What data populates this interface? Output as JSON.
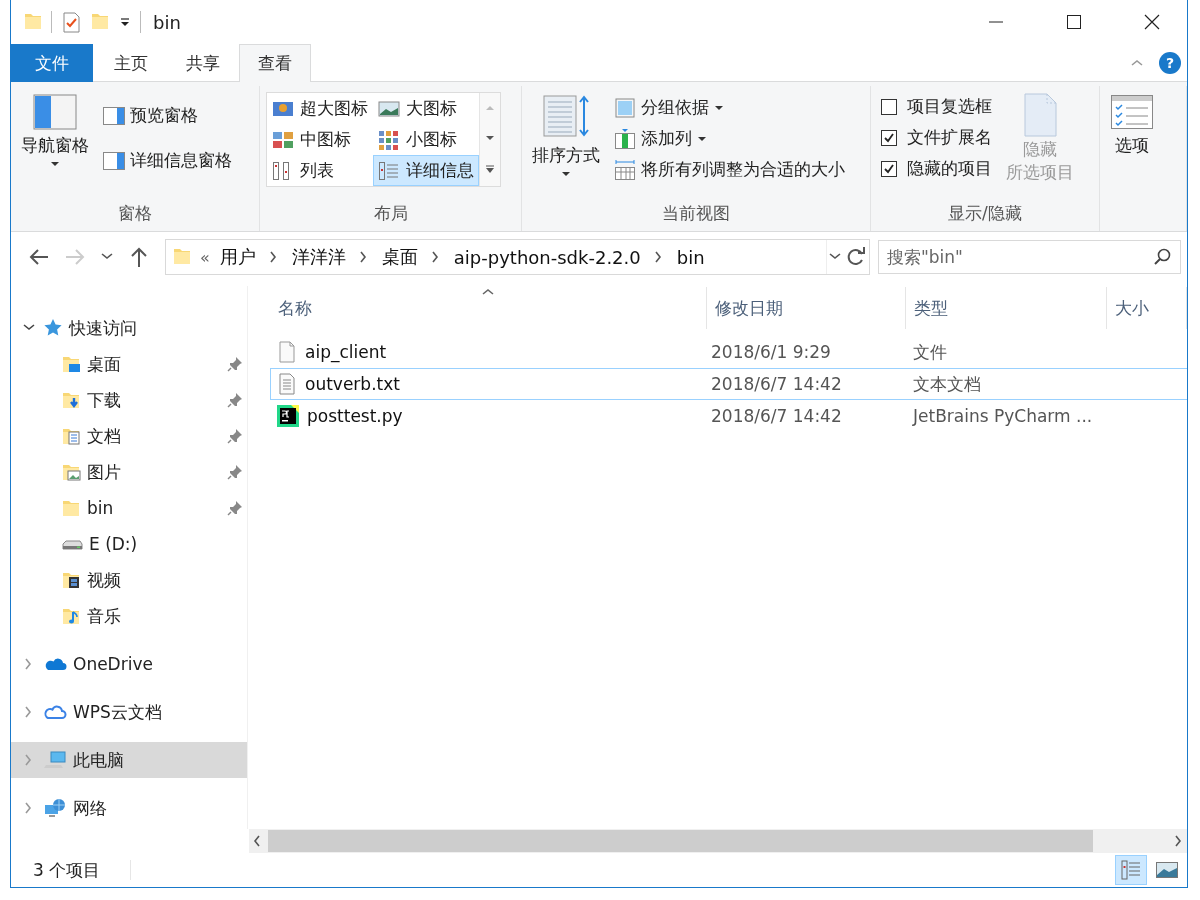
{
  "window": {
    "title": "bin"
  },
  "ribbon_tabs": [
    {
      "label": "文件",
      "kind": "file",
      "selected": false
    },
    {
      "label": "主页",
      "kind": "tab",
      "selected": false
    },
    {
      "label": "共享",
      "kind": "tab",
      "selected": false
    },
    {
      "label": "查看",
      "kind": "tab",
      "selected": true
    }
  ],
  "help": "?",
  "panes": {
    "title": "窗格",
    "nav_pane": "导航窗格",
    "preview_pane": "预览窗格",
    "details_pane": "详细信息窗格"
  },
  "layout": {
    "title": "布局",
    "options": [
      {
        "label": "超大图标",
        "kind": "xl",
        "selected": false
      },
      {
        "label": "大图标",
        "kind": "large",
        "selected": false
      },
      {
        "label": "中图标",
        "kind": "medium",
        "selected": false
      },
      {
        "label": "小图标",
        "kind": "small",
        "selected": false
      },
      {
        "label": "列表",
        "kind": "list",
        "selected": false
      },
      {
        "label": "详细信息",
        "kind": "details",
        "selected": true
      }
    ]
  },
  "current_view": {
    "title": "当前视图",
    "sort": "排序方式",
    "group_by": "分组依据",
    "add_column": "添加列",
    "fit_columns": "将所有列调整为合适的大小"
  },
  "show_hide": {
    "title": "显示/隐藏",
    "checkboxes": [
      {
        "label": "项目复选框",
        "checked": false
      },
      {
        "label": "文件扩展名",
        "checked": true
      },
      {
        "label": "隐藏的项目",
        "checked": true
      }
    ],
    "hide_selected": {
      "lines": [
        "隐藏",
        "所选项目"
      ],
      "disabled": true
    }
  },
  "options": {
    "label": "选项"
  },
  "address": {
    "overflow": "«",
    "path": [
      "用户",
      "洋洋洋",
      "桌面",
      "aip-python-sdk-2.2.0",
      "bin"
    ]
  },
  "search": {
    "placeholder": "搜索\"bin\""
  },
  "nav": [
    {
      "label": "快速访问",
      "kind": "star",
      "expanded": true,
      "selected": false,
      "children": [
        {
          "label": "桌面",
          "kind": "desktop",
          "pinned": true,
          "selected": false
        },
        {
          "label": "下载",
          "kind": "download",
          "pinned": true,
          "selected": false
        },
        {
          "label": "文档",
          "kind": "documents",
          "pinned": true,
          "selected": false
        },
        {
          "label": "图片",
          "kind": "pictures",
          "pinned": true,
          "selected": false
        },
        {
          "label": "bin",
          "kind": "folder",
          "pinned": true,
          "selected": false
        },
        {
          "label": "E (D:)",
          "kind": "drive",
          "pinned": false,
          "selected": false
        },
        {
          "label": "视频",
          "kind": "videos",
          "pinned": false,
          "selected": false
        },
        {
          "label": "音乐",
          "kind": "music",
          "pinned": false,
          "selected": false
        }
      ]
    },
    {
      "label": "OneDrive",
      "kind": "onedrive",
      "expanded": false,
      "selected": false
    },
    {
      "label": "WPS云文档",
      "kind": "cloud",
      "expanded": false,
      "selected": false
    },
    {
      "label": "此电脑",
      "kind": "computer",
      "expanded": false,
      "selected": true
    },
    {
      "label": "网络",
      "kind": "network",
      "expanded": false,
      "selected": false
    }
  ],
  "table": {
    "columns": [
      "名称",
      "修改日期",
      "类型",
      "大小"
    ],
    "rows": [
      {
        "name": "aip_client",
        "date": "2018/6/1 9:29",
        "type": "文件",
        "kind": "file",
        "focused": false
      },
      {
        "name": "outverb.txt",
        "date": "2018/6/7 14:42",
        "type": "文本文档",
        "kind": "text",
        "focused": true
      },
      {
        "name": "posttest.py",
        "date": "2018/6/7 14:42",
        "type": "JetBrains PyCharm ...",
        "kind": "pycharm",
        "focused": false
      }
    ]
  },
  "status_bar": {
    "count": "3 个项目",
    "view_buttons": [
      {
        "kind": "details",
        "selected": true
      },
      {
        "kind": "large",
        "selected": false
      }
    ]
  }
}
